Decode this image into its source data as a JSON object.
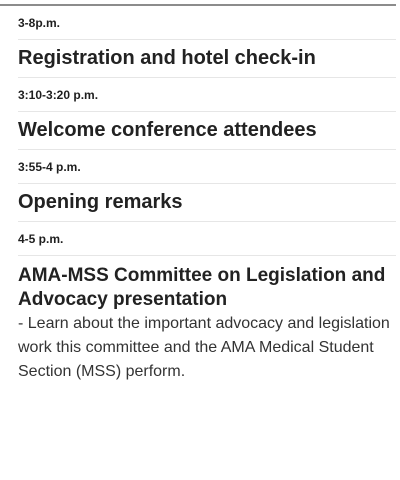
{
  "schedule": {
    "items": [
      {
        "time": "3-8p.m.",
        "title": "Registration and hotel check-in"
      },
      {
        "time": "3:10-3:20 p.m.",
        "title": "Welcome conference attendees"
      },
      {
        "time": "3:55-4 p.m.",
        "title": "Opening remarks"
      },
      {
        "time": "4-5 p.m.",
        "title": "AMA-MSS Committee on Legislation and Advocacy presentation",
        "description": "- Learn about the important advocacy and legislation work this committee and the AMA Medical Student Section (MSS) perform."
      }
    ]
  }
}
